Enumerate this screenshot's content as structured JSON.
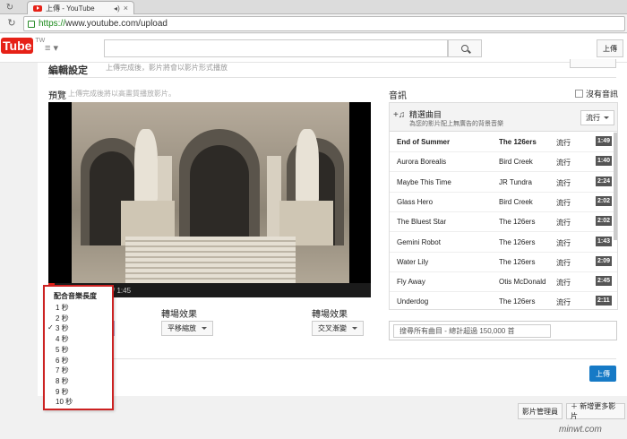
{
  "browser": {
    "tab_title": "上傳 - YouTube",
    "url_scheme": "https://",
    "url_rest": "www.youtube.com/upload"
  },
  "header": {
    "logo_you": "You",
    "logo_tube": "Tube",
    "logo_region": "TW",
    "upload_label": "上傳"
  },
  "editor": {
    "section_title": "編輯設定",
    "section_subtitle": "上傳完成後，影片將會以影片形式播放",
    "preview_label": "預覽",
    "preview_hint": "上傳完成後將以高畫質播放影片。",
    "video_time": "/ 1:45",
    "video_progress": 0.02,
    "transition_label_1": "轉場效果",
    "transition_value_1": "平移縮放",
    "transition_label_2": "轉場效果",
    "transition_value_2": "交叉漸變",
    "upload_button": "上傳"
  },
  "audio": {
    "label": "音訊",
    "no_audio_label": "沒有音訊",
    "featured_title": "精選曲目",
    "featured_subtitle": "為您的影片配上無廣告的背景音樂",
    "genre_button": "流行",
    "search_placeholder": "搜尋所有曲目 - 總計超過 150,000 首",
    "tracks": [
      {
        "title": "End of Summer",
        "artist": "The 126ers",
        "genre": "流行",
        "duration": "1:49"
      },
      {
        "title": "Aurora Borealis",
        "artist": "Bird Creek",
        "genre": "流行",
        "duration": "1:40"
      },
      {
        "title": "Maybe This Time",
        "artist": "JR Tundra",
        "genre": "流行",
        "duration": "2:24"
      },
      {
        "title": "Glass Hero",
        "artist": "Bird Creek",
        "genre": "流行",
        "duration": "2:02"
      },
      {
        "title": "The Bluest Star",
        "artist": "The 126ers",
        "genre": "流行",
        "duration": "2:02"
      },
      {
        "title": "Gemini Robot",
        "artist": "The 126ers",
        "genre": "流行",
        "duration": "1:43"
      },
      {
        "title": "Water Lily",
        "artist": "The 126ers",
        "genre": "流行",
        "duration": "2:09"
      },
      {
        "title": "Fly Away",
        "artist": "Otis McDonald",
        "genre": "流行",
        "duration": "2:45"
      },
      {
        "title": "Underdog",
        "artist": "The 126ers",
        "genre": "流行",
        "duration": "2:11"
      }
    ]
  },
  "duration_dropdown": {
    "header": "配合音樂長度",
    "selected": "3 秒",
    "options": [
      "1 秒",
      "2 秒",
      "3 秒",
      "4 秒",
      "5 秒",
      "6 秒",
      "7 秒",
      "8 秒",
      "9 秒",
      "10 秒"
    ]
  },
  "footer": {
    "video_manager": "影片管理員",
    "add_more_videos": "＋ 新增更多影片"
  },
  "watermark": "minwt.com"
}
